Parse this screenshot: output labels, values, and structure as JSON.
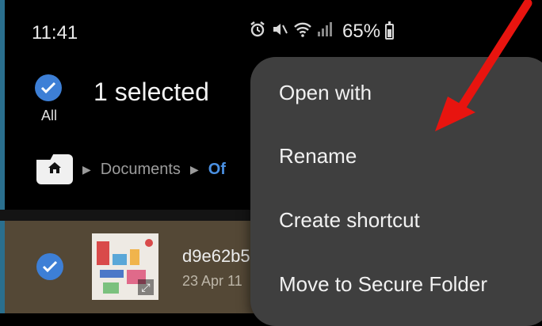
{
  "status_bar": {
    "time": "11:41",
    "battery_percent": "65%",
    "icons": [
      "alarm-icon",
      "mute-icon",
      "wifi-icon",
      "signal-icon",
      "battery-icon"
    ]
  },
  "selection": {
    "all_label": "All",
    "count_text": "1 selected"
  },
  "breadcrumb": {
    "items": [
      "Documents",
      "Of"
    ]
  },
  "file": {
    "name": "d9e62b5",
    "date": "23 Apr 11"
  },
  "context_menu": {
    "items": [
      "Open with",
      "Rename",
      "Create shortcut",
      "Move to Secure Folder"
    ]
  },
  "colors": {
    "accent": "#3d7fd6",
    "menu_bg": "#3f3f3f",
    "selected_row_bg": "#544836",
    "annotation_arrow": "#e8140f"
  }
}
